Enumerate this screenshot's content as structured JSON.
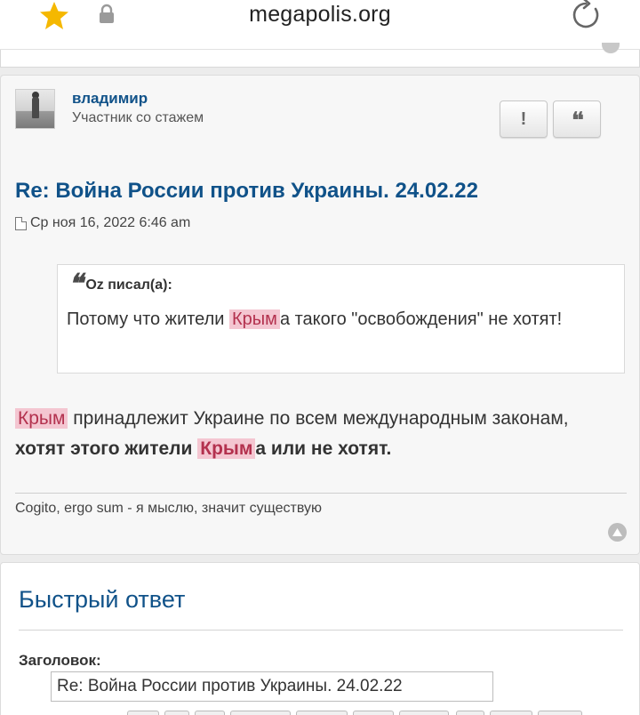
{
  "browser": {
    "url": "megapolis.org",
    "icons": [
      "star-icon",
      "lock-icon",
      "reload-icon"
    ],
    "star_color": "#f5b800"
  },
  "post": {
    "author": "владимир",
    "rank": "Участник со стажем",
    "report_label": "!",
    "quote_label": "“",
    "title": "Re: Война России против Украины. 24.02.22",
    "date": "Ср ноя 16, 2022 6:46 am",
    "quote": {
      "author_line": "Oz писал(а):",
      "text_before": "Потому что жители ",
      "highlight": "Крым",
      "text_after": "а такого \"освобождения\" не хотят!"
    },
    "body": {
      "hl1": "Крым",
      "part1": " принадлежит Украине по всем международным законам, ",
      "bold1": "хотят этого жители ",
      "hl2": "Крым",
      "bold2": "а или не хотят."
    },
    "signature": "Cogito, ergo sum - я мыслю, значит существую"
  },
  "quick_reply": {
    "title": "Быстрый ответ",
    "subject_label": "Заголовок:",
    "subject_value": "Re: Война России против Украины. 24.02.22"
  },
  "colors": {
    "link_blue": "#105289",
    "highlight_bg": "#f4c6d1",
    "highlight_text": "#b3314e"
  }
}
